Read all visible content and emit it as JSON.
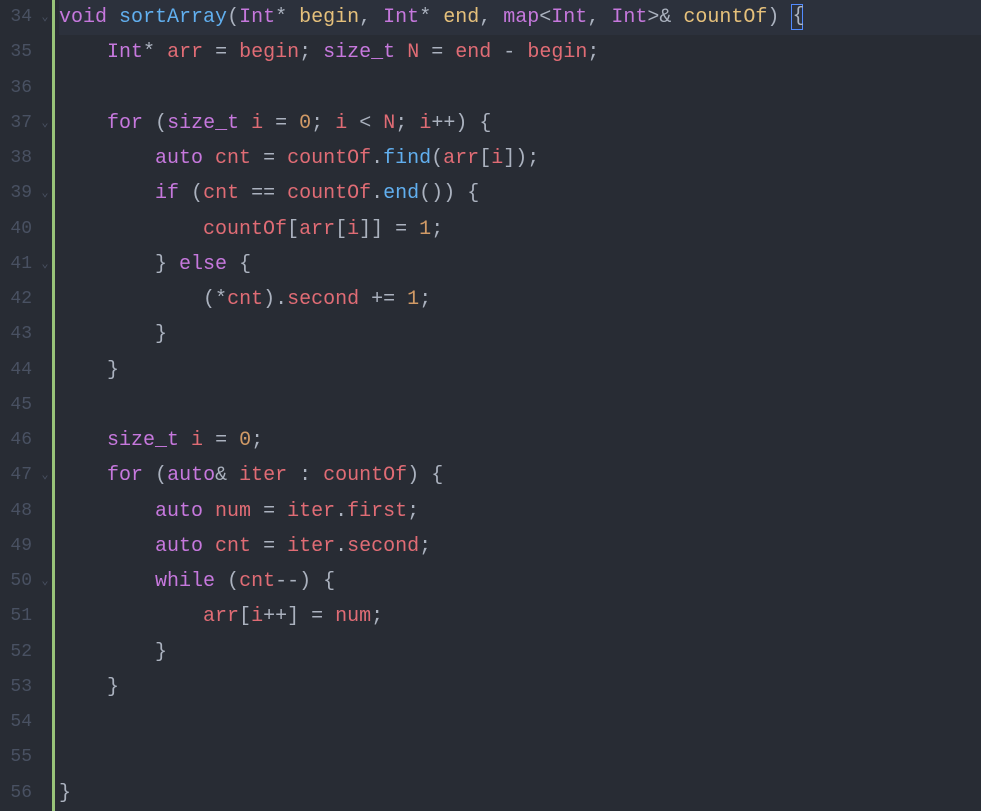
{
  "editor": {
    "startLine": 34,
    "lines": [
      {
        "n": 34,
        "fold": "v",
        "hl": true,
        "tokens": [
          {
            "c": "tok-keyword",
            "t": "void"
          },
          {
            "c": "tok-white",
            "t": " "
          },
          {
            "c": "tok-func",
            "t": "sortArray"
          },
          {
            "c": "tok-paren",
            "t": "("
          },
          {
            "c": "tok-type",
            "t": "Int"
          },
          {
            "c": "tok-op",
            "t": "*"
          },
          {
            "c": "tok-white",
            "t": " "
          },
          {
            "c": "tok-param",
            "t": "begin"
          },
          {
            "c": "tok-punc",
            "t": ","
          },
          {
            "c": "tok-white",
            "t": " "
          },
          {
            "c": "tok-type",
            "t": "Int"
          },
          {
            "c": "tok-op",
            "t": "*"
          },
          {
            "c": "tok-white",
            "t": " "
          },
          {
            "c": "tok-param",
            "t": "end"
          },
          {
            "c": "tok-punc",
            "t": ","
          },
          {
            "c": "tok-white",
            "t": " "
          },
          {
            "c": "tok-type",
            "t": "map"
          },
          {
            "c": "tok-op",
            "t": "<"
          },
          {
            "c": "tok-type",
            "t": "Int"
          },
          {
            "c": "tok-punc",
            "t": ","
          },
          {
            "c": "tok-white",
            "t": " "
          },
          {
            "c": "tok-type",
            "t": "Int"
          },
          {
            "c": "tok-op",
            "t": ">&"
          },
          {
            "c": "tok-white",
            "t": " "
          },
          {
            "c": "tok-param",
            "t": "countOf"
          },
          {
            "c": "tok-paren",
            "t": ")"
          },
          {
            "c": "tok-white",
            "t": " "
          },
          {
            "c": "cursor-box",
            "t": "{"
          }
        ]
      },
      {
        "n": 35,
        "fold": "",
        "tokens": [
          {
            "c": "tok-white",
            "t": "    "
          },
          {
            "c": "tok-type",
            "t": "Int"
          },
          {
            "c": "tok-op",
            "t": "*"
          },
          {
            "c": "tok-white",
            "t": " "
          },
          {
            "c": "tok-var",
            "t": "arr"
          },
          {
            "c": "tok-white",
            "t": " "
          },
          {
            "c": "tok-op",
            "t": "="
          },
          {
            "c": "tok-white",
            "t": " "
          },
          {
            "c": "tok-var",
            "t": "begin"
          },
          {
            "c": "tok-punc",
            "t": ";"
          },
          {
            "c": "tok-white",
            "t": " "
          },
          {
            "c": "tok-type",
            "t": "size_t"
          },
          {
            "c": "tok-white",
            "t": " "
          },
          {
            "c": "tok-var",
            "t": "N"
          },
          {
            "c": "tok-white",
            "t": " "
          },
          {
            "c": "tok-op",
            "t": "="
          },
          {
            "c": "tok-white",
            "t": " "
          },
          {
            "c": "tok-var",
            "t": "end"
          },
          {
            "c": "tok-white",
            "t": " "
          },
          {
            "c": "tok-op",
            "t": "-"
          },
          {
            "c": "tok-white",
            "t": " "
          },
          {
            "c": "tok-var",
            "t": "begin"
          },
          {
            "c": "tok-punc",
            "t": ";"
          }
        ]
      },
      {
        "n": 36,
        "fold": "",
        "tokens": []
      },
      {
        "n": 37,
        "fold": "v",
        "tokens": [
          {
            "c": "tok-white",
            "t": "    "
          },
          {
            "c": "tok-keyword",
            "t": "for"
          },
          {
            "c": "tok-white",
            "t": " "
          },
          {
            "c": "tok-paren",
            "t": "("
          },
          {
            "c": "tok-type",
            "t": "size_t"
          },
          {
            "c": "tok-white",
            "t": " "
          },
          {
            "c": "tok-var",
            "t": "i"
          },
          {
            "c": "tok-white",
            "t": " "
          },
          {
            "c": "tok-op",
            "t": "="
          },
          {
            "c": "tok-white",
            "t": " "
          },
          {
            "c": "tok-num",
            "t": "0"
          },
          {
            "c": "tok-punc",
            "t": ";"
          },
          {
            "c": "tok-white",
            "t": " "
          },
          {
            "c": "tok-var",
            "t": "i"
          },
          {
            "c": "tok-white",
            "t": " "
          },
          {
            "c": "tok-op",
            "t": "<"
          },
          {
            "c": "tok-white",
            "t": " "
          },
          {
            "c": "tok-var",
            "t": "N"
          },
          {
            "c": "tok-punc",
            "t": ";"
          },
          {
            "c": "tok-white",
            "t": " "
          },
          {
            "c": "tok-var",
            "t": "i"
          },
          {
            "c": "tok-op",
            "t": "++"
          },
          {
            "c": "tok-paren",
            "t": ")"
          },
          {
            "c": "tok-white",
            "t": " "
          },
          {
            "c": "tok-punc",
            "t": "{"
          }
        ]
      },
      {
        "n": 38,
        "fold": "",
        "tokens": [
          {
            "c": "tok-white",
            "t": "        "
          },
          {
            "c": "tok-keyword",
            "t": "auto"
          },
          {
            "c": "tok-white",
            "t": " "
          },
          {
            "c": "tok-var",
            "t": "cnt"
          },
          {
            "c": "tok-white",
            "t": " "
          },
          {
            "c": "tok-op",
            "t": "="
          },
          {
            "c": "tok-white",
            "t": " "
          },
          {
            "c": "tok-var",
            "t": "countOf"
          },
          {
            "c": "tok-punc",
            "t": "."
          },
          {
            "c": "tok-func",
            "t": "find"
          },
          {
            "c": "tok-paren",
            "t": "("
          },
          {
            "c": "tok-var",
            "t": "arr"
          },
          {
            "c": "tok-punc",
            "t": "["
          },
          {
            "c": "tok-var",
            "t": "i"
          },
          {
            "c": "tok-punc",
            "t": "]"
          },
          {
            "c": "tok-paren",
            "t": ")"
          },
          {
            "c": "tok-punc",
            "t": ";"
          }
        ]
      },
      {
        "n": 39,
        "fold": "v",
        "tokens": [
          {
            "c": "tok-white",
            "t": "        "
          },
          {
            "c": "tok-keyword",
            "t": "if"
          },
          {
            "c": "tok-white",
            "t": " "
          },
          {
            "c": "tok-paren",
            "t": "("
          },
          {
            "c": "tok-var",
            "t": "cnt"
          },
          {
            "c": "tok-white",
            "t": " "
          },
          {
            "c": "tok-op",
            "t": "=="
          },
          {
            "c": "tok-white",
            "t": " "
          },
          {
            "c": "tok-var",
            "t": "countOf"
          },
          {
            "c": "tok-punc",
            "t": "."
          },
          {
            "c": "tok-func",
            "t": "end"
          },
          {
            "c": "tok-paren",
            "t": "()"
          },
          {
            "c": "tok-paren",
            "t": ")"
          },
          {
            "c": "tok-white",
            "t": " "
          },
          {
            "c": "tok-punc",
            "t": "{"
          }
        ]
      },
      {
        "n": 40,
        "fold": "",
        "tokens": [
          {
            "c": "tok-white",
            "t": "            "
          },
          {
            "c": "tok-var",
            "t": "countOf"
          },
          {
            "c": "tok-punc",
            "t": "["
          },
          {
            "c": "tok-var",
            "t": "arr"
          },
          {
            "c": "tok-punc",
            "t": "["
          },
          {
            "c": "tok-var",
            "t": "i"
          },
          {
            "c": "tok-punc",
            "t": "]]"
          },
          {
            "c": "tok-white",
            "t": " "
          },
          {
            "c": "tok-op",
            "t": "="
          },
          {
            "c": "tok-white",
            "t": " "
          },
          {
            "c": "tok-num",
            "t": "1"
          },
          {
            "c": "tok-punc",
            "t": ";"
          }
        ]
      },
      {
        "n": 41,
        "fold": "v",
        "tokens": [
          {
            "c": "tok-white",
            "t": "        "
          },
          {
            "c": "tok-punc",
            "t": "}"
          },
          {
            "c": "tok-white",
            "t": " "
          },
          {
            "c": "tok-keyword",
            "t": "else"
          },
          {
            "c": "tok-white",
            "t": " "
          },
          {
            "c": "tok-punc",
            "t": "{"
          }
        ]
      },
      {
        "n": 42,
        "fold": "",
        "tokens": [
          {
            "c": "tok-white",
            "t": "            "
          },
          {
            "c": "tok-paren",
            "t": "("
          },
          {
            "c": "tok-op",
            "t": "*"
          },
          {
            "c": "tok-var",
            "t": "cnt"
          },
          {
            "c": "tok-paren",
            "t": ")"
          },
          {
            "c": "tok-punc",
            "t": "."
          },
          {
            "c": "tok-prop",
            "t": "second"
          },
          {
            "c": "tok-white",
            "t": " "
          },
          {
            "c": "tok-op",
            "t": "+="
          },
          {
            "c": "tok-white",
            "t": " "
          },
          {
            "c": "tok-num",
            "t": "1"
          },
          {
            "c": "tok-punc",
            "t": ";"
          }
        ]
      },
      {
        "n": 43,
        "fold": "",
        "tokens": [
          {
            "c": "tok-white",
            "t": "        "
          },
          {
            "c": "tok-punc",
            "t": "}"
          }
        ]
      },
      {
        "n": 44,
        "fold": "",
        "tokens": [
          {
            "c": "tok-white",
            "t": "    "
          },
          {
            "c": "tok-punc",
            "t": "}"
          }
        ]
      },
      {
        "n": 45,
        "fold": "",
        "tokens": []
      },
      {
        "n": 46,
        "fold": "",
        "tokens": [
          {
            "c": "tok-white",
            "t": "    "
          },
          {
            "c": "tok-type",
            "t": "size_t"
          },
          {
            "c": "tok-white",
            "t": " "
          },
          {
            "c": "tok-var",
            "t": "i"
          },
          {
            "c": "tok-white",
            "t": " "
          },
          {
            "c": "tok-op",
            "t": "="
          },
          {
            "c": "tok-white",
            "t": " "
          },
          {
            "c": "tok-num",
            "t": "0"
          },
          {
            "c": "tok-punc",
            "t": ";"
          }
        ]
      },
      {
        "n": 47,
        "fold": "v",
        "tokens": [
          {
            "c": "tok-white",
            "t": "    "
          },
          {
            "c": "tok-keyword",
            "t": "for"
          },
          {
            "c": "tok-white",
            "t": " "
          },
          {
            "c": "tok-paren",
            "t": "("
          },
          {
            "c": "tok-keyword",
            "t": "auto"
          },
          {
            "c": "tok-op",
            "t": "&"
          },
          {
            "c": "tok-white",
            "t": " "
          },
          {
            "c": "tok-var",
            "t": "iter"
          },
          {
            "c": "tok-white",
            "t": " "
          },
          {
            "c": "tok-op",
            "t": ":"
          },
          {
            "c": "tok-white",
            "t": " "
          },
          {
            "c": "tok-var",
            "t": "countOf"
          },
          {
            "c": "tok-paren",
            "t": ")"
          },
          {
            "c": "tok-white",
            "t": " "
          },
          {
            "c": "tok-punc",
            "t": "{"
          }
        ]
      },
      {
        "n": 48,
        "fold": "",
        "tokens": [
          {
            "c": "tok-white",
            "t": "        "
          },
          {
            "c": "tok-keyword",
            "t": "auto"
          },
          {
            "c": "tok-white",
            "t": " "
          },
          {
            "c": "tok-var",
            "t": "num"
          },
          {
            "c": "tok-white",
            "t": " "
          },
          {
            "c": "tok-op",
            "t": "="
          },
          {
            "c": "tok-white",
            "t": " "
          },
          {
            "c": "tok-var",
            "t": "iter"
          },
          {
            "c": "tok-punc",
            "t": "."
          },
          {
            "c": "tok-prop",
            "t": "first"
          },
          {
            "c": "tok-punc",
            "t": ";"
          }
        ]
      },
      {
        "n": 49,
        "fold": "",
        "tokens": [
          {
            "c": "tok-white",
            "t": "        "
          },
          {
            "c": "tok-keyword",
            "t": "auto"
          },
          {
            "c": "tok-white",
            "t": " "
          },
          {
            "c": "tok-var",
            "t": "cnt"
          },
          {
            "c": "tok-white",
            "t": " "
          },
          {
            "c": "tok-op",
            "t": "="
          },
          {
            "c": "tok-white",
            "t": " "
          },
          {
            "c": "tok-var",
            "t": "iter"
          },
          {
            "c": "tok-punc",
            "t": "."
          },
          {
            "c": "tok-prop",
            "t": "second"
          },
          {
            "c": "tok-punc",
            "t": ";"
          }
        ]
      },
      {
        "n": 50,
        "fold": "v",
        "tokens": [
          {
            "c": "tok-white",
            "t": "        "
          },
          {
            "c": "tok-keyword",
            "t": "while"
          },
          {
            "c": "tok-white",
            "t": " "
          },
          {
            "c": "tok-paren",
            "t": "("
          },
          {
            "c": "tok-var",
            "t": "cnt"
          },
          {
            "c": "tok-op",
            "t": "--"
          },
          {
            "c": "tok-paren",
            "t": ")"
          },
          {
            "c": "tok-white",
            "t": " "
          },
          {
            "c": "tok-punc",
            "t": "{"
          }
        ]
      },
      {
        "n": 51,
        "fold": "",
        "tokens": [
          {
            "c": "tok-white",
            "t": "            "
          },
          {
            "c": "tok-var",
            "t": "arr"
          },
          {
            "c": "tok-punc",
            "t": "["
          },
          {
            "c": "tok-var",
            "t": "i"
          },
          {
            "c": "tok-op",
            "t": "++"
          },
          {
            "c": "tok-punc",
            "t": "]"
          },
          {
            "c": "tok-white",
            "t": " "
          },
          {
            "c": "tok-op",
            "t": "="
          },
          {
            "c": "tok-white",
            "t": " "
          },
          {
            "c": "tok-var",
            "t": "num"
          },
          {
            "c": "tok-punc",
            "t": ";"
          }
        ]
      },
      {
        "n": 52,
        "fold": "",
        "tokens": [
          {
            "c": "tok-white",
            "t": "        "
          },
          {
            "c": "tok-punc",
            "t": "}"
          }
        ]
      },
      {
        "n": 53,
        "fold": "",
        "tokens": [
          {
            "c": "tok-white",
            "t": "    "
          },
          {
            "c": "tok-punc",
            "t": "}"
          }
        ]
      },
      {
        "n": 54,
        "fold": "",
        "tokens": []
      },
      {
        "n": 55,
        "fold": "",
        "tokens": []
      },
      {
        "n": 56,
        "fold": "",
        "tokens": [
          {
            "c": "tok-punc",
            "t": "}"
          }
        ]
      }
    ]
  }
}
